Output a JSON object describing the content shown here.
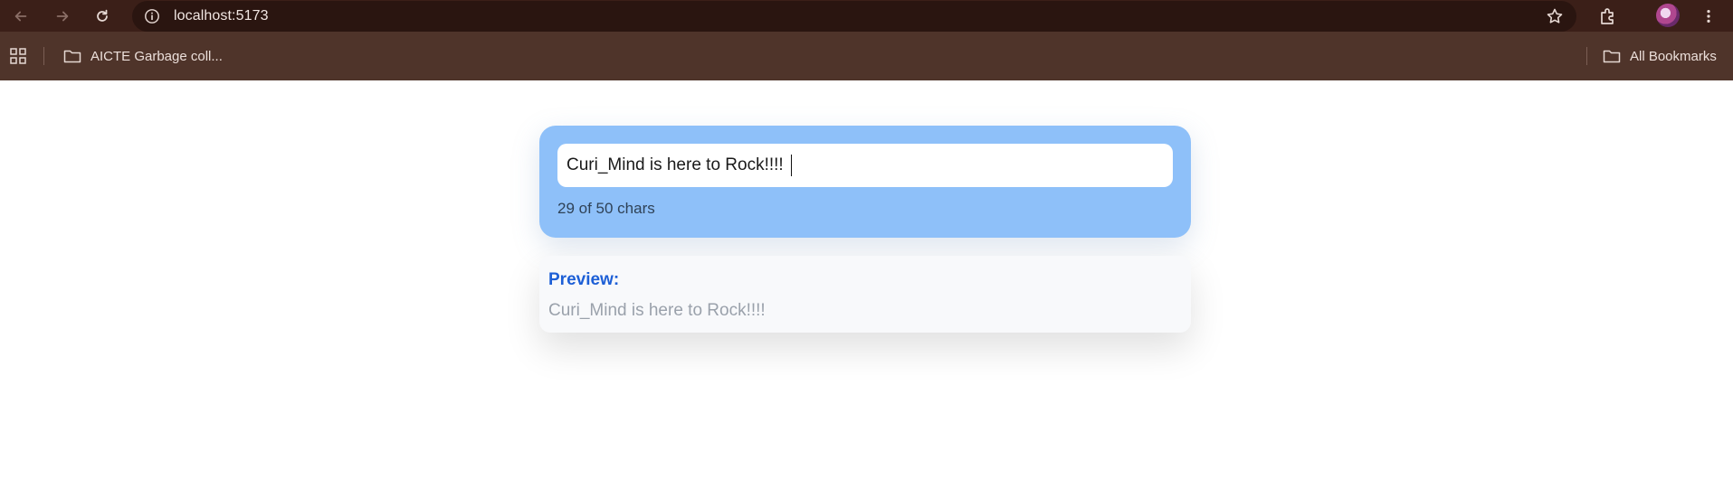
{
  "browser": {
    "url": "localhost:5173",
    "bookmarks": [
      {
        "label": "AICTE Garbage coll..."
      }
    ],
    "all_bookmarks_label": "All Bookmarks"
  },
  "editor": {
    "input_value": "Curi_Mind is here to Rock!!!!",
    "char_count_text": "29 of 50 chars"
  },
  "preview": {
    "title": "Preview:",
    "text": "Curi_Mind is here to Rock!!!!"
  },
  "colors": {
    "chrome_top": "#3b1f18",
    "bookmarks_bar": "#4f342a",
    "editor_card": "#8ec0f9",
    "preview_title": "#1d5fd6",
    "preview_text": "#9aa1ab"
  }
}
